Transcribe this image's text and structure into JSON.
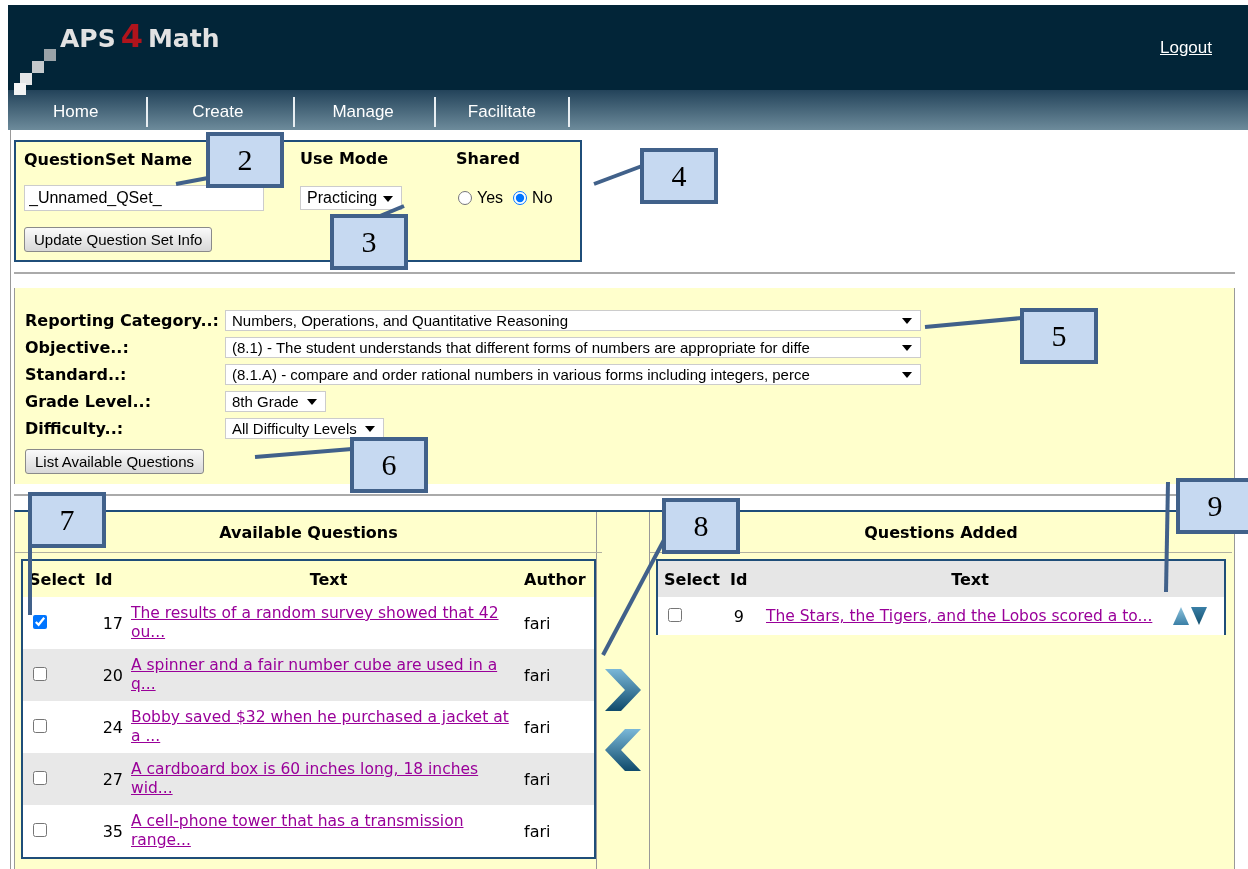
{
  "header": {
    "logo": {
      "part_1": "APS",
      "part_2": "4",
      "part_3": "Math"
    },
    "logout": "Logout"
  },
  "nav": [
    {
      "label": "Home"
    },
    {
      "label": "Create"
    },
    {
      "label": "Manage"
    },
    {
      "label": "Facilitate"
    }
  ],
  "question_set": {
    "name_label": "QuestionSet Name",
    "name_value": "_Unnamed_QSet_",
    "use_mode_label": "Use Mode",
    "use_mode_value": "Practicing",
    "shared_label": "Shared",
    "shared_options": [
      {
        "label": "Yes",
        "selected": false
      },
      {
        "label": "No",
        "selected": true
      }
    ],
    "update_button": "Update Question Set Info"
  },
  "filters": [
    {
      "label": "Reporting Category..:",
      "value": "Numbers, Operations, and Quantitative Reasoning",
      "kind": "wide"
    },
    {
      "label": "Objective..:",
      "value": "(8.1) - The student understands that different forms of numbers are appropriate for diffe",
      "kind": "wide"
    },
    {
      "label": "Standard..:",
      "value": "(8.1.A) - compare and order rational numbers in various forms including integers, perce",
      "kind": "wide"
    },
    {
      "label": "Grade Level..:",
      "value": "8th Grade",
      "kind": "compact"
    },
    {
      "label": "Difficulty..:",
      "value": "All Difficulty Levels",
      "kind": "compact"
    }
  ],
  "list_button": "List Available Questions",
  "available": {
    "title": "Available Questions",
    "columns": [
      "Select",
      "Id",
      "Text",
      "Author"
    ],
    "rows": [
      {
        "checked": true,
        "id": "17",
        "text": "The results of a random survey showed that 42 ou...",
        "author": "fari"
      },
      {
        "checked": false,
        "id": "20",
        "text": "A spinner and a fair number cube are used in a q...",
        "author": "fari"
      },
      {
        "checked": false,
        "id": "24",
        "text": "Bobby saved $32 when he purchased a jacket at a ...",
        "author": "fari"
      },
      {
        "checked": false,
        "id": "27",
        "text": "A cardboard box is 60 inches long, 18 inches wid...",
        "author": "fari"
      },
      {
        "checked": false,
        "id": "35",
        "text": "A cell-phone tower that has a transmission range...",
        "author": "fari"
      }
    ]
  },
  "added": {
    "title": "Questions Added",
    "columns": [
      "Select",
      "Id",
      "Text"
    ],
    "rows": [
      {
        "checked": false,
        "id": "9",
        "text": "The Stars, the Tigers, and the Lobos scored a to..."
      }
    ]
  },
  "callouts": [
    {
      "label": "2"
    },
    {
      "label": "3"
    },
    {
      "label": "4"
    },
    {
      "label": "5"
    },
    {
      "label": "6"
    },
    {
      "label": "7"
    },
    {
      "label": "8"
    },
    {
      "label": "9"
    }
  ]
}
